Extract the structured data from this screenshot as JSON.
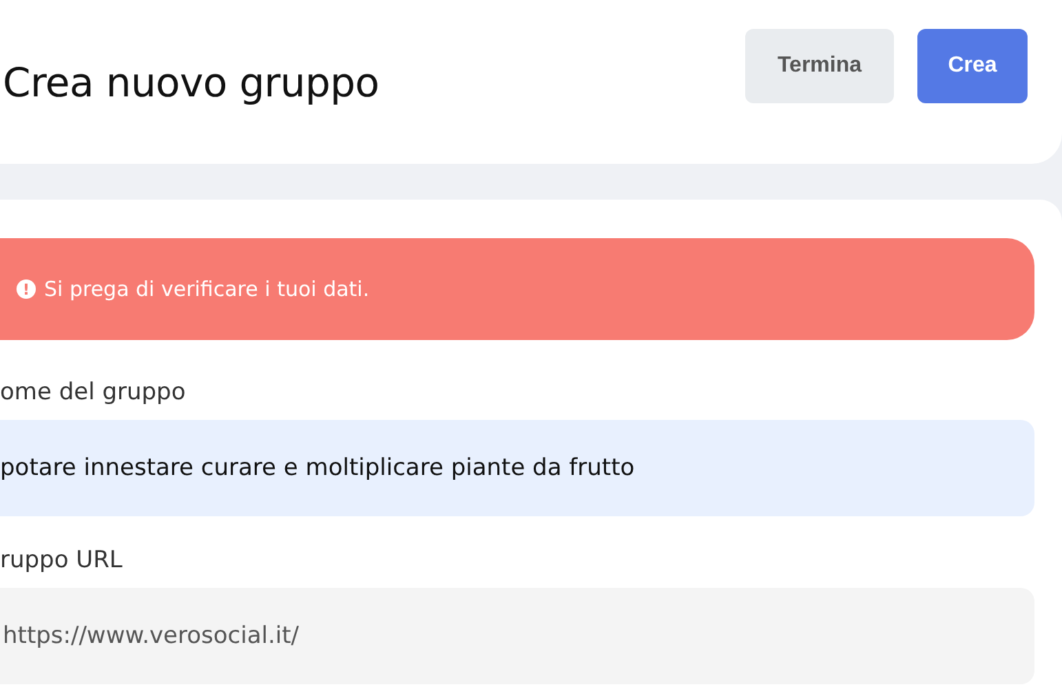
{
  "header": {
    "title": "Crea nuovo gruppo",
    "buttons": [
      {
        "label": "Termina",
        "kind": "secondary"
      },
      {
        "label": "Crea",
        "kind": "primary"
      }
    ]
  },
  "alert": {
    "icon": "!",
    "message": "Si prega di verificare i tuoi dati."
  },
  "fields": [
    {
      "label": "ome del gruppo",
      "value": "potare innestare curare e moltiplicare piante da frutto",
      "kind": "filled"
    },
    {
      "label": "ruppo URL",
      "value": "https://www.verosocial.it/",
      "kind": "prefix"
    }
  ]
}
